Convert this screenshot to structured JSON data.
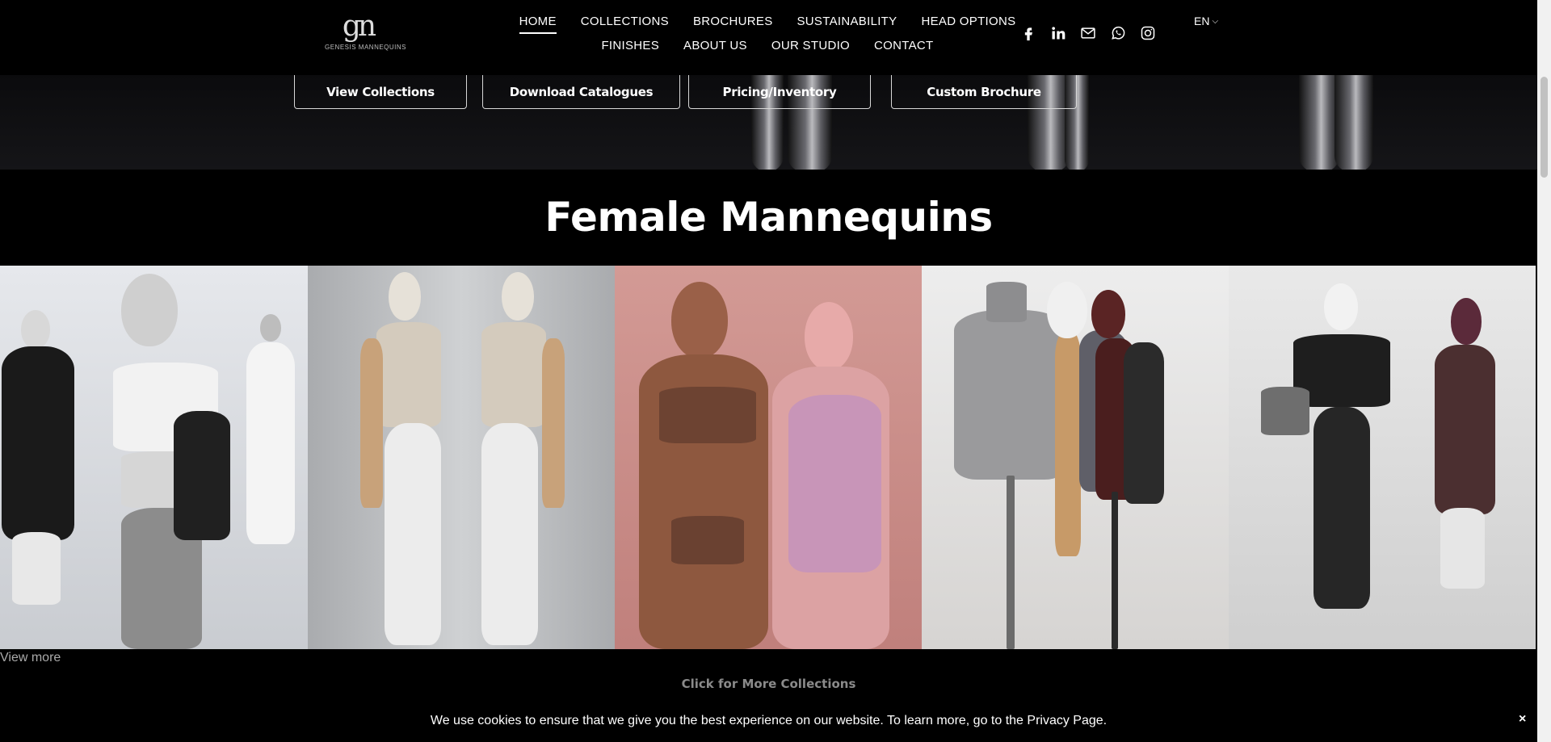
{
  "header": {
    "logo_mark": "gn",
    "logo_text": "GENESIS MANNEQUINS",
    "nav_row1": [
      "HOME",
      "COLLECTIONS",
      "BROCHURES",
      "SUSTAINABILITY",
      "HEAD OPTIONS"
    ],
    "nav_row2": [
      "FINISHES",
      "ABOUT US",
      "OUR STUDIO",
      "CONTACT"
    ],
    "active_nav": "HOME",
    "socials": [
      "facebook-icon",
      "linkedin-icon",
      "mail-icon",
      "whatsapp-icon",
      "instagram-icon"
    ],
    "language": "EN",
    "language_caret": "❯"
  },
  "hero": {
    "buttons": [
      "View Collections",
      "Download Catalogues",
      "Pricing/Inventory",
      "Custom Brochure"
    ]
  },
  "section": {
    "title": "Female Mannequins",
    "view_more": "View more"
  },
  "footer": {
    "more_collections": "Click for More Collections",
    "cookie_text": "We use cookies to ensure that we give you the best experience on our website. To learn more, go to the Privacy Page.",
    "cookie_close": "×"
  },
  "colors": {
    "background": "#000000",
    "text": "#ffffff",
    "muted": "#8a8a8a",
    "tile_pink": "#c98e8a"
  }
}
